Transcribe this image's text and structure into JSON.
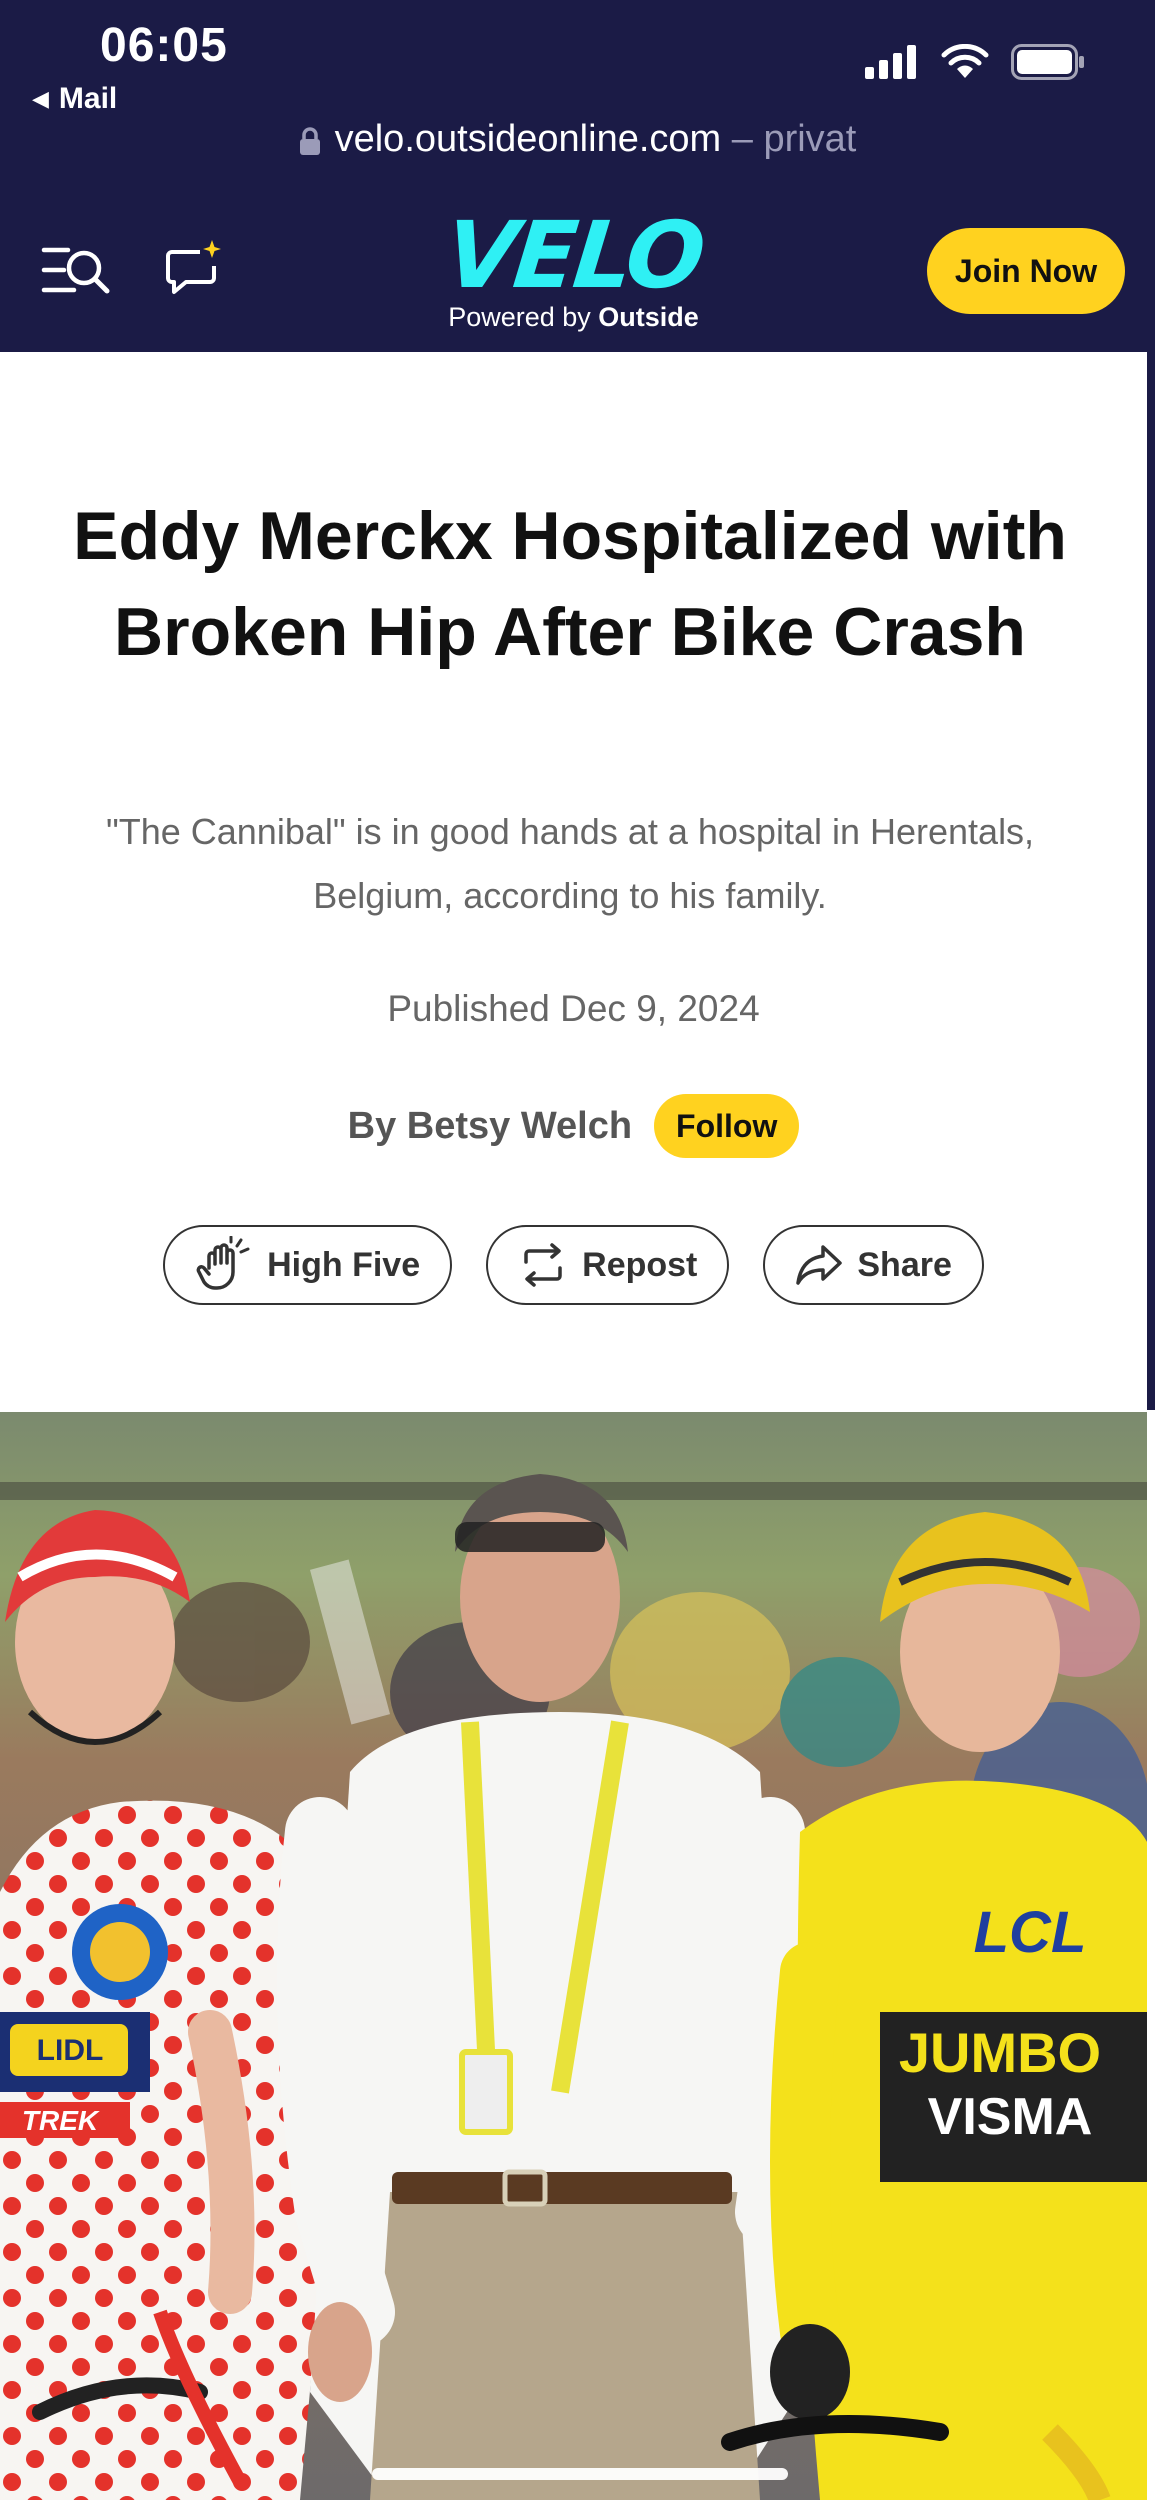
{
  "status_bar": {
    "time": "06:05",
    "back_label": "Mail",
    "url": "velo.outsideonline.com",
    "url_suffix": "– privat",
    "icons": [
      "cellular-signal-icon",
      "wifi-icon",
      "battery-icon",
      "lock-icon"
    ]
  },
  "header": {
    "logo": "VELO",
    "powered_prefix": "Powered by",
    "powered_brand": "Outside",
    "join_label": "Join Now",
    "icons": [
      "menu-search-icon",
      "chat-sparkle-icon"
    ]
  },
  "article": {
    "title": "Eddy Merckx Hospitalized with Broken Hip After Bike Crash",
    "dek": "\"The Cannibal\" is in good hands at a hospital in Herentals, Belgium, according to his family.",
    "published": "Published Dec 9, 2024",
    "author": "By Betsy Welch",
    "follow_label": "Follow",
    "actions": {
      "high_five": "High Five",
      "repost": "Repost",
      "share": "Share"
    }
  },
  "photo_text": {
    "jersey_left": "LIDL",
    "jersey_left_sub": "TREK",
    "jersey_right_top": "LCL",
    "jersey_right_main": "JUMBO",
    "jersey_right_main2": "VISMA"
  },
  "colors": {
    "navy": "#1b1b46",
    "accent_cyan": "#2ff0f4",
    "accent_yellow": "#ffd21f"
  }
}
